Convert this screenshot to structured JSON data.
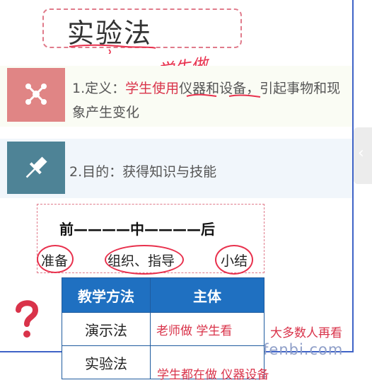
{
  "slide": {
    "title": "实验法",
    "handwriting_note": "学生做",
    "definition": {
      "prefix": "1.定义：",
      "highlight": "学生使用",
      "rest": "仪器和设备，引起事物和现象产生变化"
    },
    "purpose": "2.目的：获得知识与技能",
    "sequence": {
      "line": "前————中————后",
      "items": [
        "准备",
        "组织、指导",
        "小结"
      ]
    },
    "table": {
      "headers": [
        "教学方法",
        "主体"
      ],
      "rows": [
        {
          "method": "演示法",
          "subject": "老师做  学生看"
        },
        {
          "method": "实验法",
          "subject": "学生都在做  仪器设备"
        }
      ]
    },
    "side_note": "大多数人再看",
    "watermark": "fenbi.com"
  },
  "colors": {
    "frame": "#3f63c7",
    "accent_red": "#d9334a",
    "icon1_bg": "#e08585",
    "icon2_bg": "#4e8396",
    "table_header": "#1f70c1"
  },
  "icons": [
    "network-icon",
    "pin-icon",
    "question-mark-icon",
    "chevron-left-icon"
  ]
}
